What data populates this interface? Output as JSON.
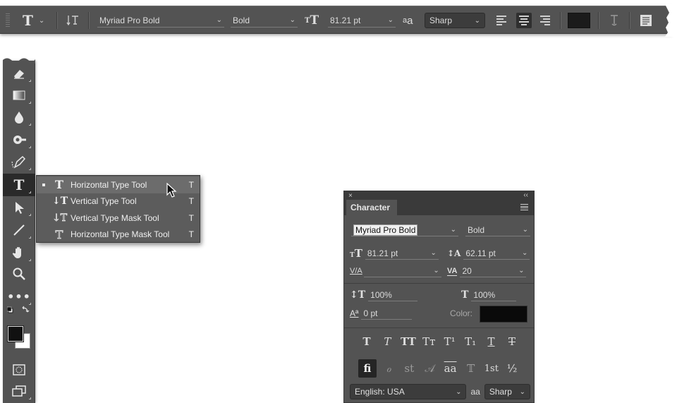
{
  "options_bar": {
    "tool_icon": "T",
    "orient_icon": "text-orientation-icon",
    "font_family": "Myriad Pro Bold",
    "font_style": "Bold",
    "font_size": "81.21 pt",
    "antialias_icon_text": "a",
    "antialias": "Sharp",
    "text_color": "#1b1b1b"
  },
  "toolbar": {
    "active_tool": "T"
  },
  "flyout": {
    "items": [
      {
        "icon": "T",
        "label": "Horizontal Type Tool",
        "key": "T"
      },
      {
        "icon": "↓T",
        "label": "Vertical Type Tool",
        "key": "T"
      },
      {
        "icon": "↓T",
        "label": "Vertical Type Mask Tool",
        "key": "T"
      },
      {
        "icon": "T",
        "label": "Horizontal Type Mask Tool",
        "key": "T"
      }
    ]
  },
  "character_panel": {
    "close": "×",
    "collapse": "‹‹",
    "title": "Character",
    "font_family": "Myriad Pro Bold",
    "font_style": "Bold",
    "font_size": "81.21 pt",
    "leading": "62.11 pt",
    "kerning_label": "V/A",
    "kerning": "",
    "tracking": "20",
    "vertical_scale": "100%",
    "horizontal_scale": "100%",
    "baseline_shift": "0 pt",
    "color_label": "Color:",
    "color": "#0a0a0a",
    "style_buttons": [
      "T",
      "T",
      "TT",
      "Tт",
      "T¹",
      "T₁",
      "T",
      "T"
    ],
    "opentype_buttons": [
      "fi",
      "ℴ",
      "st",
      "𝒜",
      "aa",
      "𝕋",
      "1st",
      "½"
    ],
    "language": "English: USA",
    "antialias": "Sharp"
  }
}
